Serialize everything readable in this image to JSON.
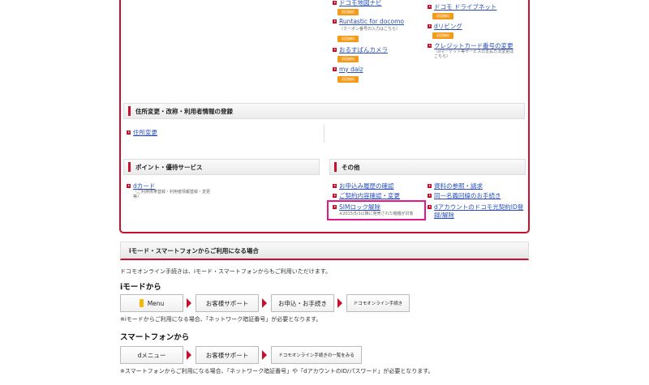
{
  "apps": {
    "col1": [
      {
        "label": "ドコモ地図ナビ",
        "badge": "初回無料"
      },
      {
        "label": "Runtastic for docomo",
        "note": "（クーポン番号の入力はこちら）",
        "badge": "初回無料"
      },
      {
        "label": "おるすばんカメラ",
        "badge": "初回無料"
      },
      {
        "label": "my daiz",
        "badge": "初回無料"
      }
    ],
    "col2": [
      {
        "label": "ドコモ ドライブネット",
        "badge": "初回無料"
      },
      {
        "label": "dリビング",
        "badge": "初回無料"
      },
      {
        "label": "クレジットカード番号の変更",
        "note1": "（dマーケット等サービスの支払方法変更は",
        "note2": "こちら）"
      }
    ]
  },
  "address_section": {
    "title": "住所変更・改称・利用者情報の登録",
    "links": [
      "住所変更"
    ]
  },
  "points_section": {
    "title": "ポイント・優待サービス",
    "link": "dカード",
    "note1": "（ご利用携帯登録・利用者情報登録・変更",
    "note2": "等）"
  },
  "other_section": {
    "title": "その他",
    "col1": [
      "お申込み履歴の確認",
      "ご契約内容確認・変更",
      "SIMロック解除"
    ],
    "sim_note": "※2015/5/1以降に発売された機種が対象",
    "col2": [
      "資料の参照・請求",
      "同一名義回線のお手続き",
      "dアカウントのドコモ光契約ID登",
      "録/解除"
    ]
  },
  "imode_section": {
    "title": "iモード・スマートフォンからご利用になる場合",
    "desc": "ドコモオンライン手続きは、iモード・スマートフォンからもご利用いただけます。",
    "imode": {
      "title": "iモードから",
      "steps": [
        "Menu",
        "お客様サポート",
        "お申込・お手続き",
        "ドコモオンライン手続き"
      ],
      "note": "※iモードからご利用になる場合、「ネットワーク暗証番号」が必要となります。"
    },
    "smart": {
      "title": "スマートフォンから",
      "steps": [
        "dメニュー",
        "お客様サポート",
        "ドコモオンライン手続きの一覧をみる"
      ],
      "note": "※スマートフォンからご利用になる場合、「ネットワーク暗証番号」や「dアカウントのID/パスワード」が必要となります。"
    }
  }
}
